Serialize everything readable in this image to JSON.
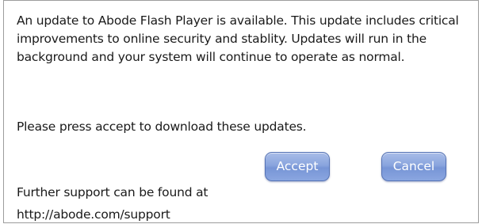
{
  "dialog": {
    "message": "An update to Abode Flash Player is available. This update includes critical improvements to online security and stablity. Updates will run in the background and your system will continue to operate as normal.",
    "prompt": "Please press accept to download these updates.",
    "support_label": "Further support can be found at",
    "support_link": "http://abode.com/support",
    "accept_label": "Accept",
    "cancel_label": "Cancel",
    "button_color": "#8aa5de",
    "border_color": "#9c9c9c"
  }
}
